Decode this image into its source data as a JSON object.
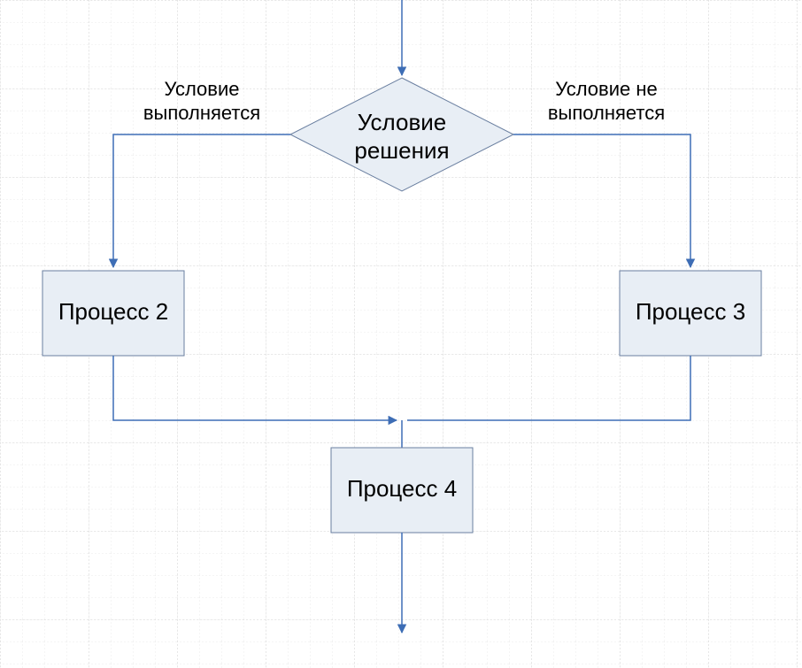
{
  "decision": {
    "line1": "Условие",
    "line2": "решения"
  },
  "labels": {
    "true_line1": "Условие",
    "true_line2": "выполняется",
    "false_line1": "Условие не",
    "false_line2": "выполняется"
  },
  "process2": "Процесс 2",
  "process3": "Процесс 3",
  "process4": "Процесс 4"
}
